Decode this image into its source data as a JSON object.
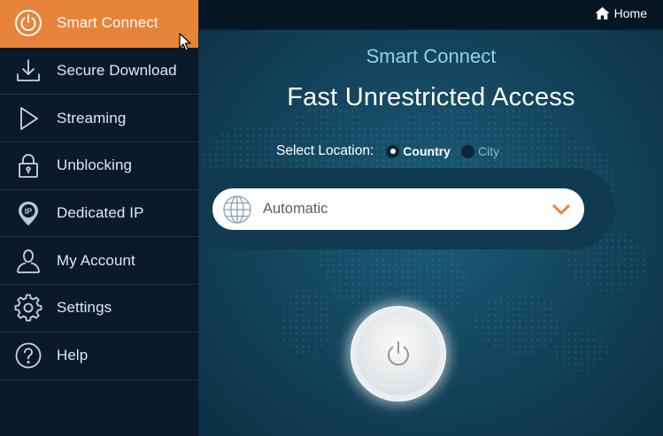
{
  "sidebar": {
    "items": [
      {
        "label": "Smart Connect",
        "icon": "power-icon",
        "active": true
      },
      {
        "label": "Secure Download",
        "icon": "download-icon",
        "active": false
      },
      {
        "label": "Streaming",
        "icon": "play-icon",
        "active": false
      },
      {
        "label": "Unblocking",
        "icon": "lock-icon",
        "active": false
      },
      {
        "label": "Dedicated IP",
        "icon": "ip-pin-icon",
        "active": false
      },
      {
        "label": "My Account",
        "icon": "user-icon",
        "active": false
      },
      {
        "label": "Settings",
        "icon": "gear-icon",
        "active": false
      },
      {
        "label": "Help",
        "icon": "help-icon",
        "active": false
      }
    ]
  },
  "topbar": {
    "home_label": "Home"
  },
  "main": {
    "subtitle": "Smart Connect",
    "title": "Fast Unrestricted Access",
    "location": {
      "label": "Select Location:",
      "options": [
        {
          "label": "Country",
          "selected": true
        },
        {
          "label": "City",
          "selected": false
        }
      ]
    },
    "select": {
      "value": "Automatic"
    }
  },
  "colors": {
    "accent": "#e8833a",
    "sidebar_bg": "#0a1a2a",
    "main_bg": "#14475f",
    "subtitle": "#8ed3ea"
  }
}
